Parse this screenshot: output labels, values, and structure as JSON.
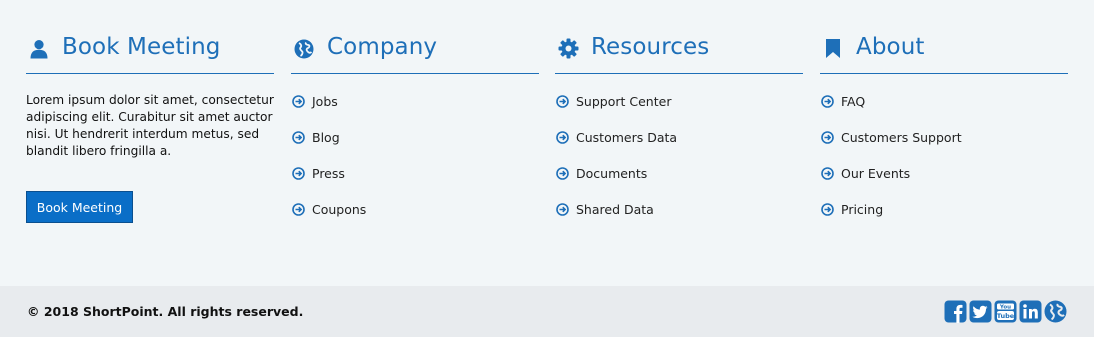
{
  "columns": [
    {
      "icon": "user-icon",
      "title": "Book Meeting",
      "description": "Lorem ipsum dolor sit amet, consectetur adipiscing elit. Curabitur sit amet auctor nisi. Ut hendrerit interdum metus, sed blandit libero fringilla a.",
      "button_label": "Book Meeting"
    },
    {
      "icon": "globe-icon",
      "title": "Company",
      "links": [
        "Jobs",
        "Blog",
        "Press",
        "Coupons"
      ]
    },
    {
      "icon": "gear-icon",
      "title": "Resources",
      "links": [
        "Support Center",
        "Customers Data",
        "Documents",
        "Shared Data"
      ]
    },
    {
      "icon": "bookmark-icon",
      "title": "About",
      "links": [
        "FAQ",
        "Customers Support",
        "Our Events",
        "Pricing"
      ]
    }
  ],
  "footer": {
    "copyright": "© 2018 ShortPoint. All rights reserved.",
    "social": [
      "facebook-icon",
      "twitter-icon",
      "youtube-icon",
      "linkedin-icon",
      "globe-icon"
    ]
  },
  "colors": {
    "accent": "#1e6fb8",
    "button": "#0a6ec7",
    "background": "#f2f6f8",
    "bottom_bar": "#e8ebee"
  }
}
